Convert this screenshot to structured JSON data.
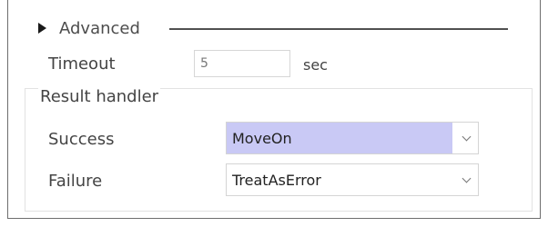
{
  "advanced": {
    "label": "Advanced",
    "expanded": false,
    "icon": "triangle-right-icon"
  },
  "timeout": {
    "label": "Timeout",
    "value": "5",
    "unit": "sec"
  },
  "result_handler": {
    "title": "Result handler",
    "success": {
      "label": "Success",
      "value": "MoveOn",
      "highlight": "#c9c9f5",
      "icon": "chevron-down-icon"
    },
    "failure": {
      "label": "Failure",
      "value": "TreatAsError",
      "icon": "chevron-down-icon"
    }
  }
}
